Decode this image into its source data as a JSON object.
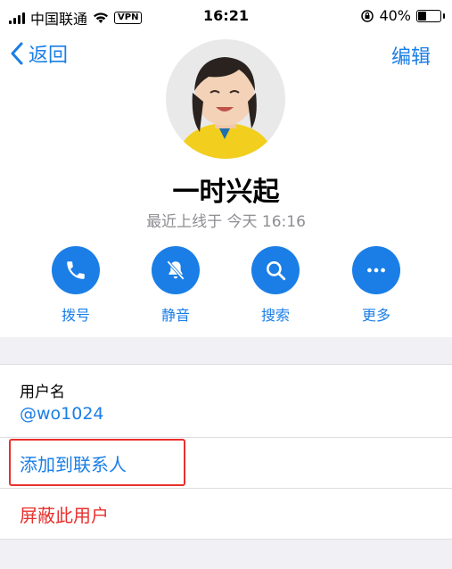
{
  "status_bar": {
    "carrier": "中国联通",
    "vpn": "VPN",
    "time": "16:21",
    "battery": "40%",
    "battery_level": 0.4
  },
  "nav": {
    "back_label": "返回",
    "edit_label": "编辑"
  },
  "profile": {
    "name": "一时兴起",
    "last_seen": "最近上线于 今天 16:16"
  },
  "actions": [
    {
      "label": "拨号",
      "icon": "phone-icon"
    },
    {
      "label": "静音",
      "icon": "bell-off-icon"
    },
    {
      "label": "搜索",
      "icon": "search-icon"
    },
    {
      "label": "更多",
      "icon": "more-icon"
    }
  ],
  "details": {
    "username_label": "用户名",
    "username_value": "@wo1024",
    "add_contact_label": "添加到联系人",
    "block_user_label": "屏蔽此用户"
  },
  "colors": {
    "accent": "#1a7ee6",
    "destructive": "#e8302d",
    "highlight_box": "#e8302d"
  }
}
